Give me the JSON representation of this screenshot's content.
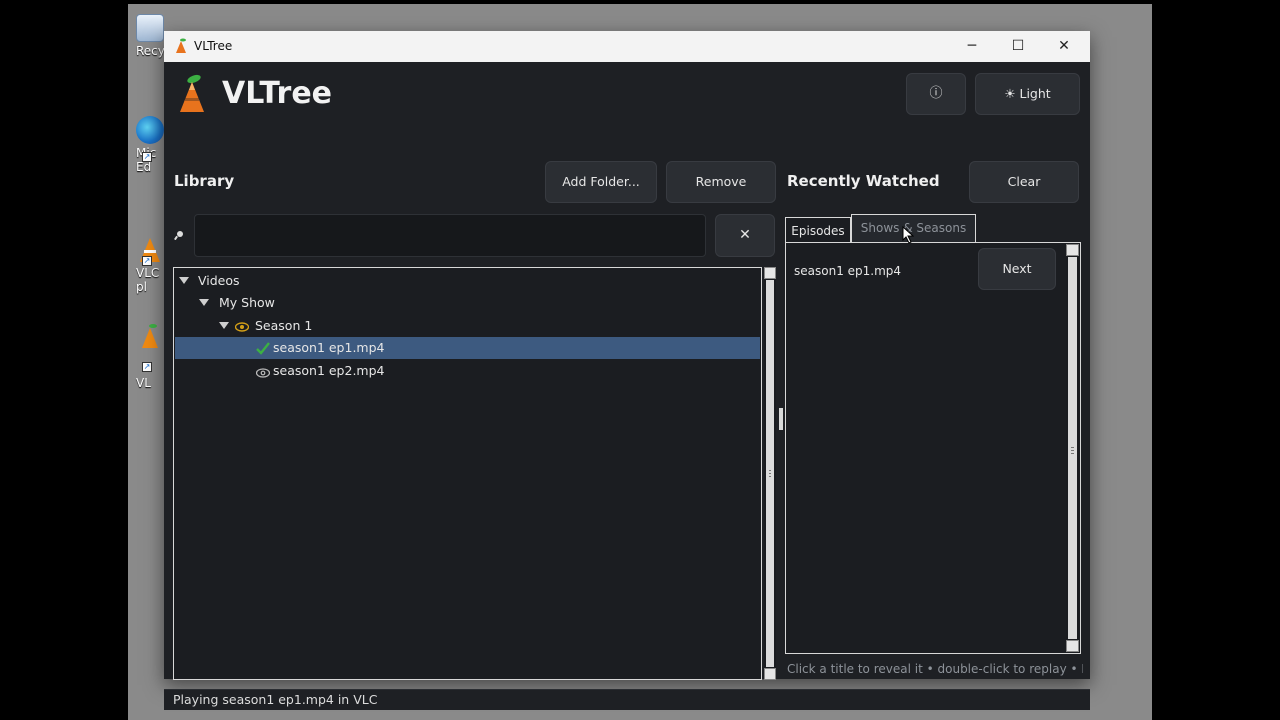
{
  "colors": {
    "window_bg": "#1e2024",
    "selection": "#3d5a80",
    "accent_orange": "#e8731d",
    "watched_check": "#3cb043",
    "eye_icon": "#d4a017"
  },
  "desktop": {
    "icons": [
      {
        "label": "Recy",
        "icon": "recycle-bin-icon"
      },
      {
        "label": "Mic\nEd",
        "icon": "edge-icon"
      },
      {
        "label": "VLC\npl",
        "icon": "vlc-icon"
      },
      {
        "label": "VL",
        "icon": "vltree-shortcut-icon"
      }
    ]
  },
  "window": {
    "title": "VLTree",
    "controls": {
      "minimize": "─",
      "maximize": "☐",
      "close": "✕"
    }
  },
  "header": {
    "app_name": "VLTree",
    "info_button": "ⓘ",
    "theme_button": "☀ Light"
  },
  "library": {
    "title": "Library",
    "add_folder_label": "Add Folder...",
    "remove_label": "Remove",
    "search_value": "",
    "clear_search_label": "✕",
    "tree": [
      {
        "label": "Videos",
        "level": 0,
        "expanded": true,
        "icon": "expand-icon"
      },
      {
        "label": "My Show",
        "level": 1,
        "expanded": true,
        "icon": "expand-icon"
      },
      {
        "label": "Season 1",
        "level": 2,
        "expanded": true,
        "icon": "eye-icon"
      },
      {
        "label": "season1 ep1.mp4",
        "level": 3,
        "icon": "checkmark-icon",
        "selected": true
      },
      {
        "label": "season1 ep2.mp4",
        "level": 3,
        "icon": "eye-outline-icon",
        "selected": false
      }
    ]
  },
  "recently_watched": {
    "title": "Recently Watched",
    "clear_label": "Clear",
    "tabs": [
      {
        "label": "Episodes",
        "active": true
      },
      {
        "label": "Shows & Seasons",
        "active": false
      }
    ],
    "items": [
      {
        "label": "season1 ep1.mp4",
        "action": "Next"
      }
    ],
    "hint": "Click a title to reveal it • double-click to replay • Next p"
  },
  "status": {
    "text": "Playing season1 ep1.mp4 in VLC"
  }
}
